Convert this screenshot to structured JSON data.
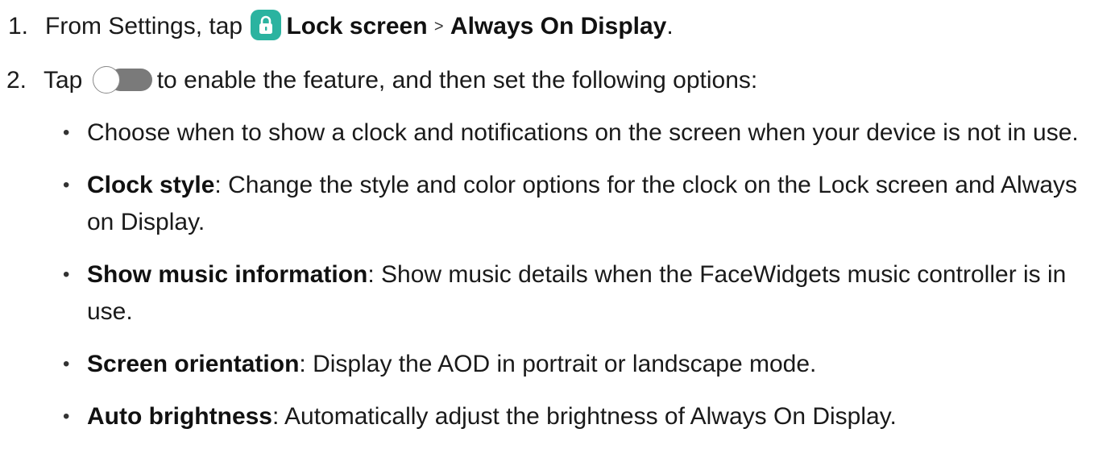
{
  "steps": [
    {
      "number": "1.",
      "before": "From Settings, tap",
      "icon": "lock-screen-icon",
      "link1": "Lock screen",
      "separator": ">",
      "link2": "Always On Display",
      "after": "."
    },
    {
      "number": "2.",
      "before": "Tap",
      "icon": "toggle-switch-icon",
      "after": "to enable the feature, and then set the following options:"
    }
  ],
  "options": [
    {
      "title": "",
      "text": "Choose when to show a clock and notifications on the screen when your device is not in use."
    },
    {
      "title": "Clock style",
      "text": ": Change the style and color options for the clock on the Lock screen and Always on Display."
    },
    {
      "title": "Show music information",
      "text": ": Show music details when the FaceWidgets music controller is in use."
    },
    {
      "title": "Screen orientation",
      "text": ": Display the AOD in portrait or landscape mode."
    },
    {
      "title": "Auto brightness",
      "text": ": Automatically adjust the brightness of Always On Display."
    }
  ],
  "colors": {
    "lock_icon_bg": "#2bb3a0",
    "toggle_track": "#7a7a7a",
    "text": "#1a1a1a"
  }
}
